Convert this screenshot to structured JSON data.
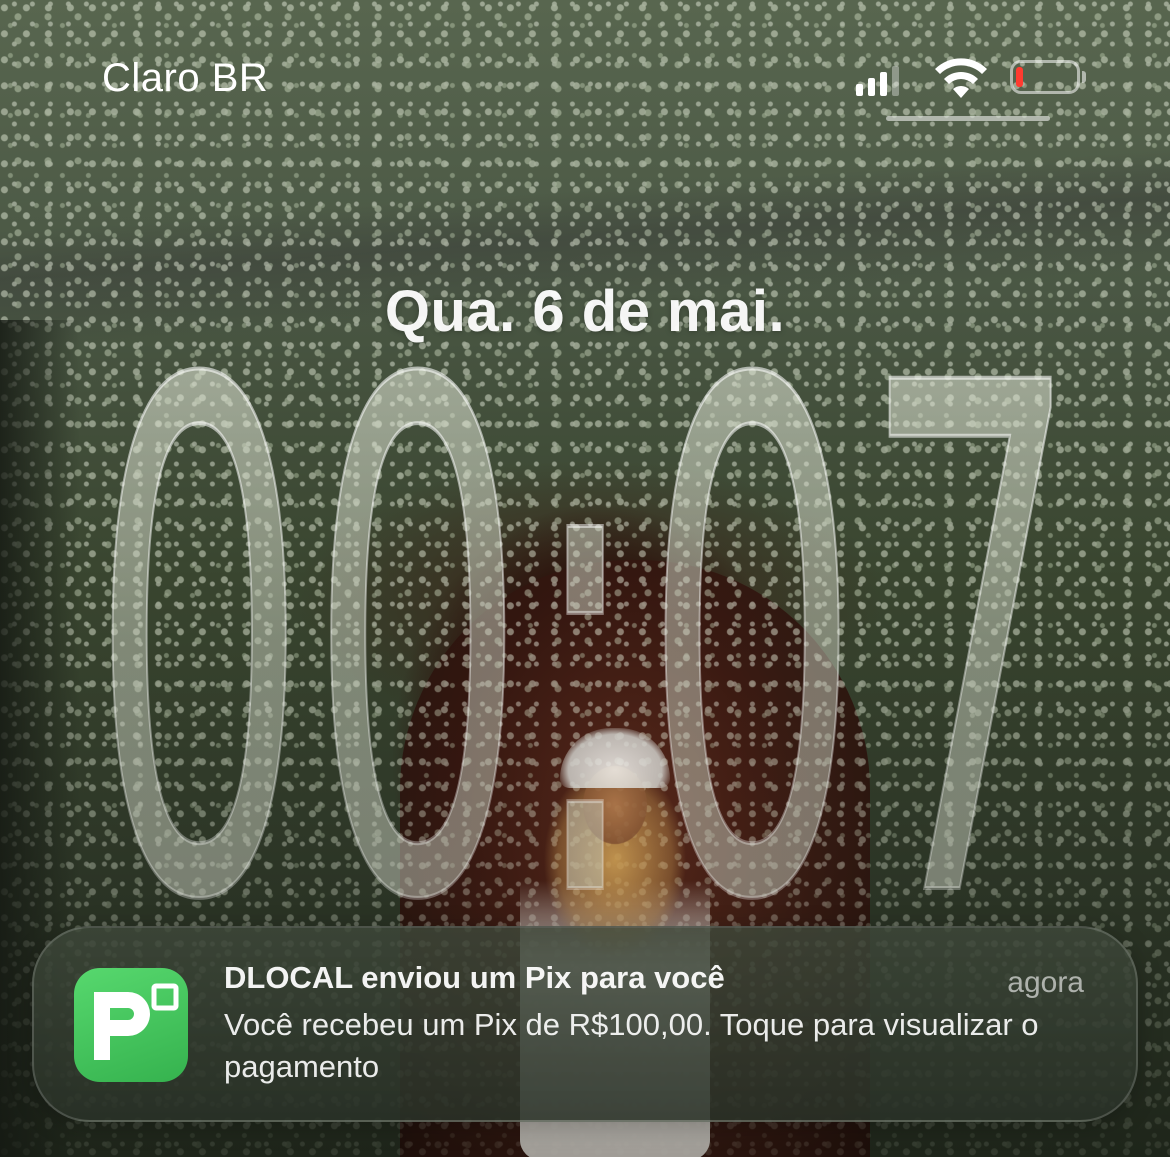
{
  "status_bar": {
    "carrier": "Claro BR",
    "signal_bars": 3,
    "signal_bars_total": 4,
    "wifi_icon": "wifi-icon",
    "battery_level_percent": 5,
    "battery_low_color": "#ff3b30"
  },
  "lock_screen": {
    "date": "Qua. 6 de mai.",
    "time": "00:07"
  },
  "notification": {
    "app_icon": "pix-logo-icon",
    "app_icon_color": "#44c55c",
    "title": "DLOCAL enviou um Pix para você",
    "time": "agora",
    "body": "Você recebeu um Pix de R$100,00. Toque para visualizar o pagamento"
  }
}
